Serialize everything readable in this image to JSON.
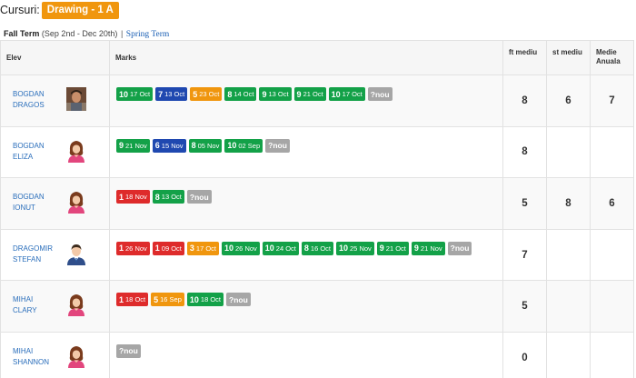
{
  "header": {
    "label": "Cursuri:",
    "course": "Drawing - 1 A"
  },
  "terms": {
    "fall": "Fall Term",
    "fall_range": "(Sep 2nd - Dec 20th)",
    "separator": "|",
    "spring": "Spring Term"
  },
  "columns": {
    "student": "Elev",
    "marks": "Marks",
    "ft": "ft mediu",
    "st": "st mediu",
    "annual": "Medie Anuala"
  },
  "colors": {
    "green": "#13a148",
    "blue": "#1f48b0",
    "orange": "#f0960e",
    "red": "#de2b2b",
    "grey": "#a6a6a6",
    "link": "#2a6ebb",
    "badge": "#f0960e"
  },
  "students": [
    {
      "first": "BOGDAN",
      "last": "DRAGOS",
      "avatar": "photo",
      "marks": [
        {
          "grade": "10",
          "date": "17 Oct",
          "color": "green"
        },
        {
          "grade": "7",
          "date": "13 Oct",
          "color": "blue"
        },
        {
          "grade": "5",
          "date": "23 Oct",
          "color": "orange"
        },
        {
          "grade": "8",
          "date": "14 Oct",
          "color": "green"
        },
        {
          "grade": "9",
          "date": "13 Oct",
          "color": "green"
        },
        {
          "grade": "9",
          "date": "21 Oct",
          "color": "green"
        },
        {
          "grade": "10",
          "date": "17 Oct",
          "color": "green"
        }
      ],
      "new_label": "?nou",
      "ft": "8",
      "st": "6",
      "annual": "7"
    },
    {
      "first": "BOGDAN",
      "last": "ELIZA",
      "avatar": "female",
      "marks": [
        {
          "grade": "9",
          "date": "21 Nov",
          "color": "green"
        },
        {
          "grade": "6",
          "date": "15 Nov",
          "color": "blue"
        },
        {
          "grade": "8",
          "date": "05 Nov",
          "color": "green"
        },
        {
          "grade": "10",
          "date": "02 Sep",
          "color": "green"
        }
      ],
      "new_label": "?nou",
      "ft": "8",
      "st": "",
      "annual": ""
    },
    {
      "first": "BOGDAN",
      "last": "IONUT",
      "avatar": "female",
      "marks": [
        {
          "grade": "1",
          "date": "18 Nov",
          "color": "red"
        },
        {
          "grade": "8",
          "date": "13 Oct",
          "color": "green"
        }
      ],
      "new_label": "?nou",
      "ft": "5",
      "st": "8",
      "annual": "6"
    },
    {
      "first": "DRAGOMIR",
      "last": "STEFAN",
      "avatar": "male",
      "marks": [
        {
          "grade": "1",
          "date": "26 Nov",
          "color": "red"
        },
        {
          "grade": "1",
          "date": "09 Oct",
          "color": "red"
        },
        {
          "grade": "3",
          "date": "17 Oct",
          "color": "orange"
        },
        {
          "grade": "10",
          "date": "26 Nov",
          "color": "green"
        },
        {
          "grade": "10",
          "date": "24 Oct",
          "color": "green"
        },
        {
          "grade": "8",
          "date": "16 Oct",
          "color": "green"
        },
        {
          "grade": "10",
          "date": "25 Nov",
          "color": "green"
        },
        {
          "grade": "9",
          "date": "21 Oct",
          "color": "green"
        },
        {
          "grade": "9",
          "date": "21 Nov",
          "color": "green"
        }
      ],
      "new_label": "?nou",
      "ft": "7",
      "st": "",
      "annual": ""
    },
    {
      "first": "MIHAI",
      "last": "CLARY",
      "avatar": "female",
      "marks": [
        {
          "grade": "1",
          "date": "18 Oct",
          "color": "red"
        },
        {
          "grade": "5",
          "date": "16 Sep",
          "color": "orange"
        },
        {
          "grade": "10",
          "date": "18 Oct",
          "color": "green"
        }
      ],
      "new_label": "?nou",
      "ft": "5",
      "st": "",
      "annual": ""
    },
    {
      "first": "MIHAI",
      "last": "SHANNON",
      "avatar": "female",
      "marks": [],
      "new_label": "?nou",
      "ft": "0",
      "st": "",
      "annual": ""
    }
  ]
}
